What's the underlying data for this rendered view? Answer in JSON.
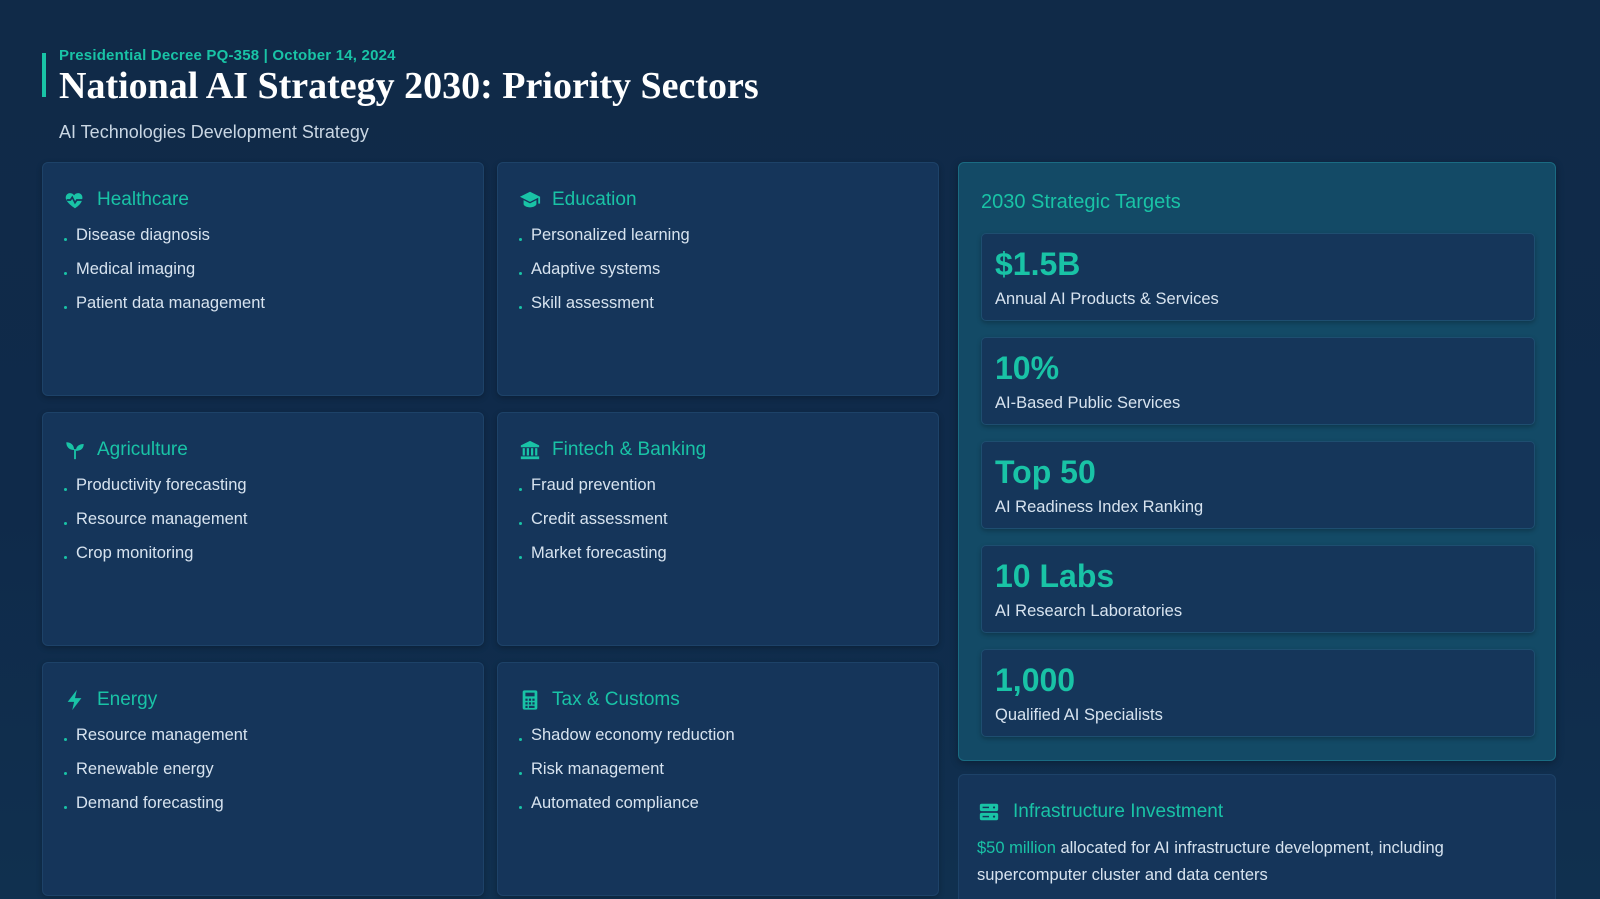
{
  "header": {
    "decree": "Presidential Decree PQ-358 | October 14, 2024",
    "title": "National AI Strategy 2030: Priority Sectors",
    "subtitle": "AI Technologies Development Strategy"
  },
  "colors": {
    "accent": "#19c3a6",
    "background": "#0f2a4a",
    "card": "#15355a",
    "targets_panel": "#134a66"
  },
  "sectors": [
    {
      "icon": "heart-pulse-icon",
      "title": "Healthcare",
      "items": [
        "Disease diagnosis",
        "Medical imaging",
        "Patient data management"
      ]
    },
    {
      "icon": "graduation-cap-icon",
      "title": "Education",
      "items": [
        "Personalized learning",
        "Adaptive systems",
        "Skill assessment"
      ]
    },
    {
      "icon": "seedling-icon",
      "title": "Agriculture",
      "items": [
        "Productivity forecasting",
        "Resource management",
        "Crop monitoring"
      ]
    },
    {
      "icon": "bank-icon",
      "title": "Fintech & Banking",
      "items": [
        "Fraud prevention",
        "Credit assessment",
        "Market forecasting"
      ]
    },
    {
      "icon": "lightning-bolt-icon",
      "title": "Energy",
      "items": [
        "Resource management",
        "Renewable energy",
        "Demand forecasting"
      ]
    },
    {
      "icon": "calculator-icon",
      "title": "Tax & Customs",
      "items": [
        "Shadow economy reduction",
        "Risk management",
        "Automated compliance"
      ]
    }
  ],
  "targets": {
    "title": "2030 Strategic Targets",
    "items": [
      {
        "value": "$1.5B",
        "label": "Annual AI Products & Services"
      },
      {
        "value": "10%",
        "label": "AI-Based Public Services"
      },
      {
        "value": "Top 50",
        "label": "AI Readiness Index Ranking"
      },
      {
        "value": "10 Labs",
        "label": "AI Research Laboratories"
      },
      {
        "value": "1,000",
        "label": "Qualified AI Specialists"
      }
    ]
  },
  "infrastructure": {
    "icon": "server-icon",
    "title": "Infrastructure Investment",
    "amount": "$50 million",
    "text": " allocated for AI infrastructure development, including supercomputer cluster and data centers"
  }
}
